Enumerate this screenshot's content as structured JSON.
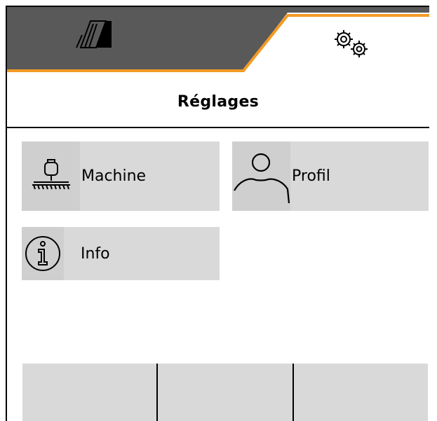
{
  "tabs": [
    {
      "icon": "field-machine-icon",
      "label": ""
    },
    {
      "icon": "gears-icon",
      "label": ""
    }
  ],
  "page_title": "Réglages",
  "menu": [
    {
      "label": "Machine",
      "icon": "machine-icon"
    },
    {
      "label": "Profil",
      "icon": "user-profile-icon"
    },
    {
      "label": "Info",
      "icon": "info-icon"
    }
  ],
  "softkeys": [
    "",
    "",
    ""
  ],
  "colors": {
    "tab_inactive": "#595959",
    "tab_accent": "#f39a24",
    "tile_bg": "#d9d9d9",
    "text": "#000000"
  }
}
